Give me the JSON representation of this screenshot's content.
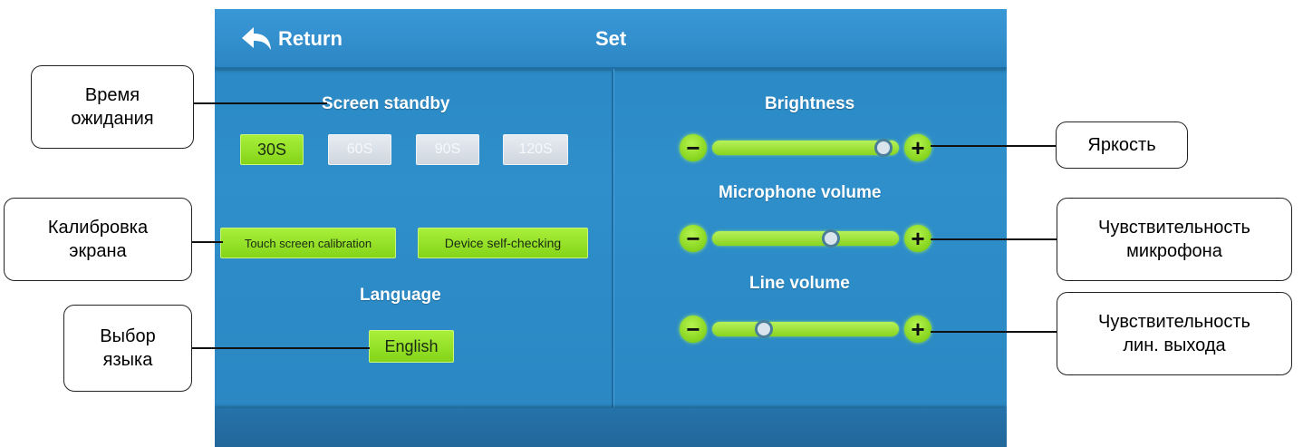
{
  "header": {
    "return_label": "Return",
    "title": "Set"
  },
  "standby": {
    "title": "Screen standby",
    "options": [
      {
        "label": "30S",
        "selected": true
      },
      {
        "label": "60S",
        "selected": false
      },
      {
        "label": "90S",
        "selected": false
      },
      {
        "label": "120S",
        "selected": false
      }
    ]
  },
  "actions": {
    "calibration": "Touch screen calibration",
    "self_check": "Device self-checking"
  },
  "language": {
    "title": "Language",
    "value": "English"
  },
  "sliders": {
    "brightness": {
      "label": "Brightness",
      "level": 0.96
    },
    "microphone": {
      "label": "Microphone volume",
      "level": 0.65
    },
    "line": {
      "label": "Line volume",
      "level": 0.25
    }
  },
  "callouts": {
    "standby": "Время\nожидания",
    "calibration": "Калибровка\nэкрана",
    "language": "Выбор\nязыка",
    "brightness": "Яркость",
    "microphone": "Чувствительность\nмикрофона",
    "line": "Чувствительность\nлин. выхода"
  },
  "colors": {
    "screen_bg": "#2e8fcb",
    "button_green": "#95e024",
    "inactive_gray": "#d8dee5"
  }
}
